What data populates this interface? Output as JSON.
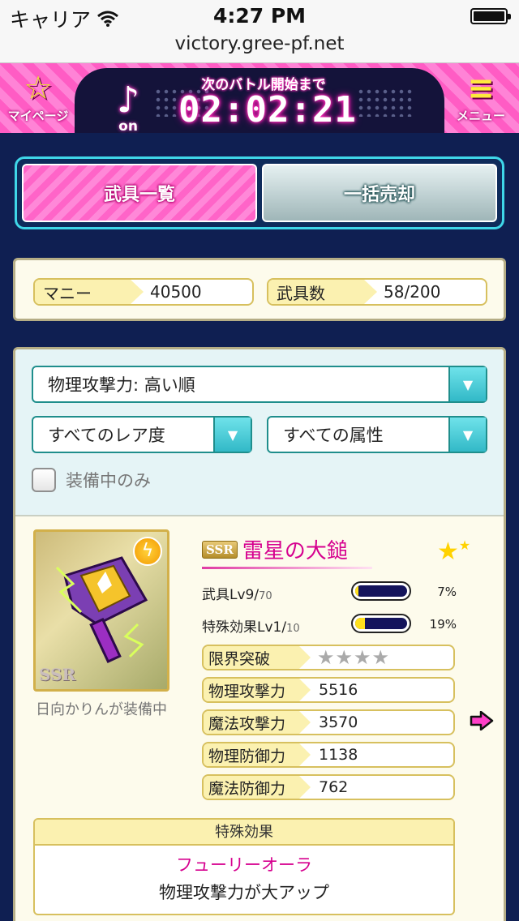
{
  "status": {
    "carrier": "キャリア",
    "time": "4:27 PM"
  },
  "browser": {
    "url": "victory.gree-pf.net"
  },
  "header": {
    "mypage_label": "マイページ",
    "music_label": "on",
    "timer_label": "次のバトル開始まで",
    "timer_value": "02:02:21",
    "menu_label": "メニュー"
  },
  "tabs": {
    "weapons": "武具一覧",
    "bulk_sell": "一括売却"
  },
  "stats": {
    "money_label": "マニー",
    "money_value": "40500",
    "weapons_label": "武具数",
    "weapons_value": "58/200"
  },
  "filters": {
    "sort": "物理攻撃力: 高い順",
    "rarity": "すべてのレア度",
    "element": "すべての属性",
    "equipped_only_label": "装備中のみ",
    "equipped_only_checked": false
  },
  "item": {
    "rarity": "SSR",
    "name": "雷星の大鎚",
    "equipped_by": "日向かりんが装備中",
    "weapon_lv_label": "武具Lv9/",
    "weapon_lv_max": "70",
    "weapon_lv_pct": "7%",
    "weapon_lv_progress": 0.07,
    "effect_lv_label": "特殊効果Lv1/",
    "effect_lv_max": "10",
    "effect_lv_pct": "19%",
    "effect_lv_progress": 0.19,
    "limit_break_label": "限界突破",
    "limit_break_stars": "★★★★",
    "phys_atk_label": "物理攻撃力",
    "phys_atk": "5516",
    "mag_atk_label": "魔法攻撃力",
    "mag_atk": "3570",
    "phys_def_label": "物理防御力",
    "phys_def": "1138",
    "mag_def_label": "魔法防御力",
    "mag_def": "762",
    "special_label": "特殊効果",
    "special_name": "フューリーオーラ",
    "special_desc": "物理攻撃力が大アップ"
  },
  "colors": {
    "accent_pink": "#ff64c8",
    "accent_cyan": "#3fd6e8",
    "navy": "#0f1f52"
  }
}
